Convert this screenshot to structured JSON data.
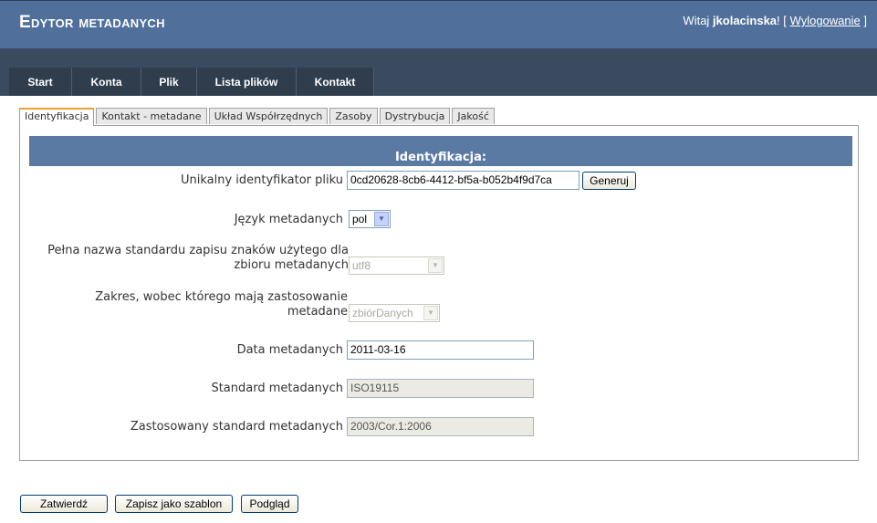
{
  "header": {
    "app_title": "Edytor metadanych",
    "greeting": "Witaj",
    "username": "jkolacinska",
    "exclaim": "!",
    "bracket_open": "[",
    "logout_label": "Wylogowanie",
    "bracket_close": "]"
  },
  "nav": {
    "tabs": [
      {
        "label": "Start"
      },
      {
        "label": "Konta"
      },
      {
        "label": "Plik"
      },
      {
        "label": "Lista plików"
      },
      {
        "label": "Kontakt"
      }
    ]
  },
  "subtabs": [
    {
      "label": "Identyfikacja",
      "active": true
    },
    {
      "label": "Kontakt - metadane"
    },
    {
      "label": "Układ Współrzędnych"
    },
    {
      "label": "Zasoby"
    },
    {
      "label": "Dystrybucja"
    },
    {
      "label": "Jakość"
    }
  ],
  "form": {
    "section_title": "Identyfikacja:",
    "file_id_label": "Unikalny identyfikator pliku",
    "file_id_value": "0cd20628-8cb6-4412-bf5a-b052b4f9d7ca",
    "generate_label": "Generuj",
    "language_label": "Język metadanych",
    "language_value": "pol",
    "charset_label_line1": "Pełna nazwa standardu zapisu znaków użytego dla",
    "charset_label_line2": "zbioru metadanych",
    "charset_value": "utf8",
    "scope_label_line1": "Zakres, wobec którego mają zastosowanie",
    "scope_label_line2": "metadane",
    "scope_value": "zbiórDanych",
    "date_label": "Data metadanych",
    "date_value": "2011-03-16",
    "standard_label": "Standard metadanych",
    "standard_value": "ISO19115",
    "standard_version_label": "Zastosowany standard metadanych",
    "standard_version_value": "2003/Cor.1:2006"
  },
  "footer": {
    "submit_label": "Zatwierdź",
    "save_template_label": "Zapisz jako szablon",
    "preview_label": "Podgląd"
  },
  "colors": {
    "header_bg": "#50709b",
    "nav_bg": "#3b4b5f",
    "tab_bg": "#2f3d4d",
    "section_header_bg": "#5a7aa3",
    "active_tab_accent": "#f0a030"
  }
}
